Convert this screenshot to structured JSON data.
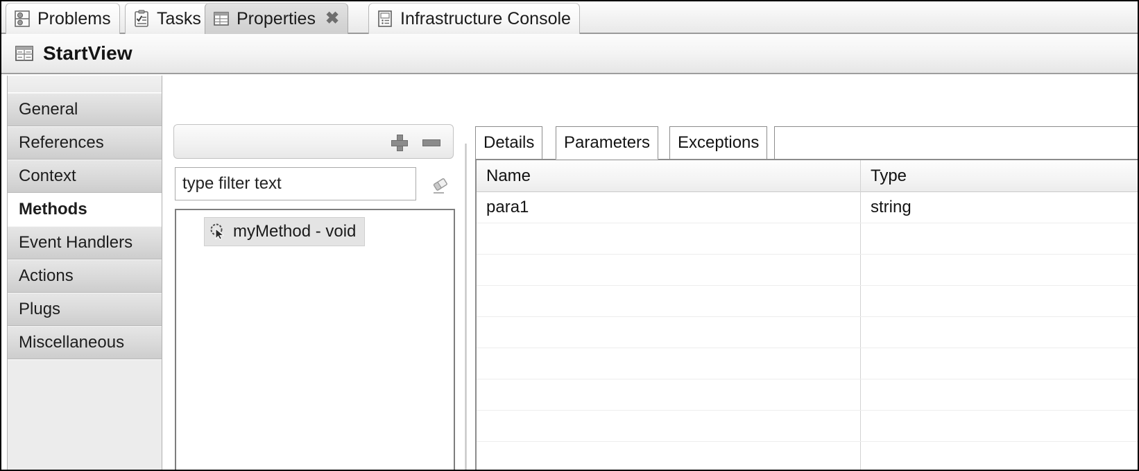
{
  "window": {
    "view_tabs": [
      {
        "label": "Problems",
        "icon": "problems-icon",
        "active": false,
        "closable": false
      },
      {
        "label": "Tasks",
        "icon": "tasks-icon",
        "active": false,
        "closable": false
      },
      {
        "label": "Properties",
        "icon": "properties-icon",
        "active": true,
        "closable": true,
        "close_glyph": "✖"
      },
      {
        "label": "Infrastructure Console",
        "icon": "console-icon",
        "active": false,
        "closable": false
      }
    ],
    "view_title": "StartView",
    "view_title_icon": "form-view-icon"
  },
  "sidebar": {
    "items": [
      {
        "label": "General",
        "selected": false
      },
      {
        "label": "References",
        "selected": false
      },
      {
        "label": "Context",
        "selected": false
      },
      {
        "label": "Methods",
        "selected": true
      },
      {
        "label": "Event Handlers",
        "selected": false
      },
      {
        "label": "Actions",
        "selected": false
      },
      {
        "label": "Plugs",
        "selected": false
      },
      {
        "label": "Miscellaneous",
        "selected": false
      }
    ]
  },
  "methods_panel": {
    "toolbar": {
      "add_label": "+",
      "add_icon": "plus-icon",
      "remove_label": "-",
      "remove_icon": "minus-icon"
    },
    "filter": {
      "value": "type filter text",
      "placeholder": "type filter text",
      "clear_icon": "eraser-icon"
    },
    "tree": [
      {
        "label": "myMethod - void",
        "icon": "method-icon",
        "selected": true
      }
    ]
  },
  "details_panel": {
    "tabs": [
      {
        "label": "Details",
        "active": false
      },
      {
        "label": "Parameters",
        "active": true
      },
      {
        "label": "Exceptions",
        "active": false
      }
    ],
    "table": {
      "columns": [
        "Name",
        "Type"
      ],
      "rows": [
        {
          "name": "para1",
          "type": "string"
        },
        {
          "name": "",
          "type": ""
        },
        {
          "name": "",
          "type": ""
        },
        {
          "name": "",
          "type": ""
        },
        {
          "name": "",
          "type": ""
        },
        {
          "name": "",
          "type": ""
        },
        {
          "name": "",
          "type": ""
        },
        {
          "name": "",
          "type": ""
        },
        {
          "name": "",
          "type": ""
        }
      ]
    }
  },
  "colors": {
    "chrome": "#ececec",
    "selected_tab": "#d7d7d7",
    "border": "#8c8c8c",
    "text": "#141414"
  }
}
